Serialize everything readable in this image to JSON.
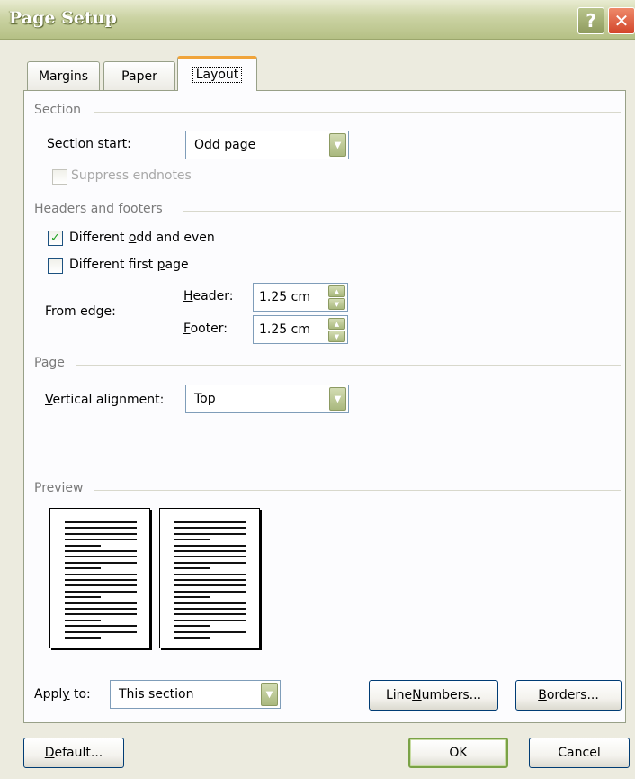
{
  "window": {
    "title": "Page Setup",
    "help_glyph": "?",
    "close_glyph": "✕"
  },
  "tabs": [
    {
      "label": "Margins",
      "active": false
    },
    {
      "label": "Paper",
      "active": false
    },
    {
      "label": "Layout",
      "active": true
    }
  ],
  "section": {
    "group_label": "Section",
    "start_label_pre": "Section sta",
    "start_label_key": "r",
    "start_label_post": "t:",
    "start_value": "Odd page",
    "suppress_endnotes_label": "Suppress endnotes",
    "suppress_endnotes_checked": false,
    "suppress_endnotes_enabled": false
  },
  "headers_footers": {
    "group_label": "Headers and footers",
    "odd_even_pre": "Different ",
    "odd_even_key": "o",
    "odd_even_post": "dd and even",
    "odd_even_checked": true,
    "first_page_pre": "Different first ",
    "first_page_key": "p",
    "first_page_post": "age",
    "first_page_checked": false,
    "from_edge_label": "From edge:",
    "header_key": "H",
    "header_post": "eader:",
    "header_value": "1.25 cm",
    "footer_key": "F",
    "footer_post": "ooter:",
    "footer_value": "1.25 cm"
  },
  "page": {
    "group_label": "Page",
    "valign_key": "V",
    "valign_post": "ertical alignment:",
    "valign_value": "Top"
  },
  "preview": {
    "group_label": "Preview"
  },
  "apply_to": {
    "label_pre": "Appl",
    "label_key": "y",
    "label_post": " to:",
    "value": "This section"
  },
  "buttons": {
    "line_numbers_pre": "Line ",
    "line_numbers_key": "N",
    "line_numbers_post": "umbers...",
    "borders_key": "B",
    "borders_post": "orders...",
    "default_key": "D",
    "default_post": "efault...",
    "ok": "OK",
    "cancel": "Cancel"
  },
  "icons": {
    "dropdown": "chevron-down-icon",
    "spin_up": "triangle-up-icon",
    "spin_down": "triangle-down-icon",
    "check": "checkmark-icon"
  },
  "colors": {
    "titlebar": "#b5c085",
    "dialog_bg": "#ecebdf",
    "group_label": "#7a7a7a",
    "active_tab_accent": "#f0a43a",
    "checkmark": "#21a121"
  }
}
